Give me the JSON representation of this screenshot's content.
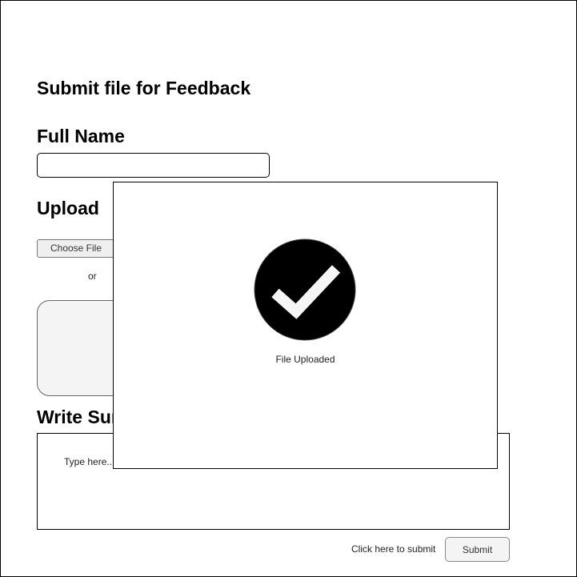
{
  "form": {
    "title": "Submit file for Feedback",
    "full_name": {
      "label": "Full Name",
      "value": "",
      "placeholder": ""
    },
    "upload": {
      "label": "Upload",
      "choose_file_label": "Choose File",
      "separator_text": "or"
    },
    "summary": {
      "label": "Write Summary",
      "placeholder": "Type here..."
    },
    "submit": {
      "hint": "Click here to submit",
      "button_label": "Submit"
    }
  },
  "modal": {
    "icon": "check-circle-icon",
    "message": "File Uploaded"
  }
}
